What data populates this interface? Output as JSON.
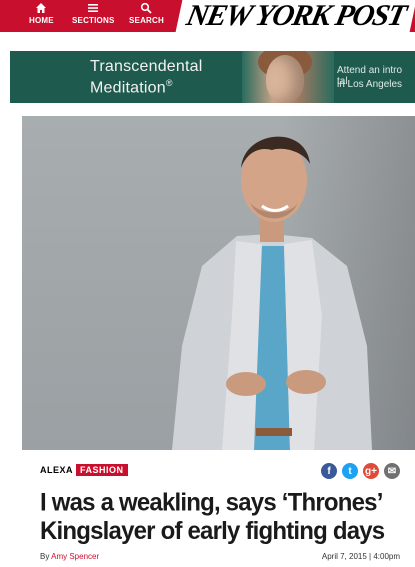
{
  "header": {
    "nav": [
      {
        "label": "HOME",
        "icon": "home-icon"
      },
      {
        "label": "SECTIONS",
        "icon": "menu-icon"
      },
      {
        "label": "SEARCH",
        "icon": "search-icon"
      }
    ],
    "logo": "NEW YORK POST",
    "brand_color": "#c8102e"
  },
  "ad": {
    "line1": "Transcendental",
    "line2": "Meditation",
    "reg": "®",
    "right1": "Attend an intro tal",
    "right2": "in Los Angeles"
  },
  "article": {
    "section_prefix": "ALEXA",
    "section": "FASHION",
    "share": [
      {
        "name": "facebook",
        "glyph": "f"
      },
      {
        "name": "twitter",
        "glyph": "t"
      },
      {
        "name": "google-plus",
        "glyph": "g+"
      },
      {
        "name": "email",
        "glyph": "✉"
      }
    ],
    "headline": "I was a weakling, says ‘Thrones’ Kingslayer of early fighting days",
    "byline_prefix": "By",
    "author": "Amy Spencer",
    "date": "April 7, 2015 | 4:00pm"
  }
}
